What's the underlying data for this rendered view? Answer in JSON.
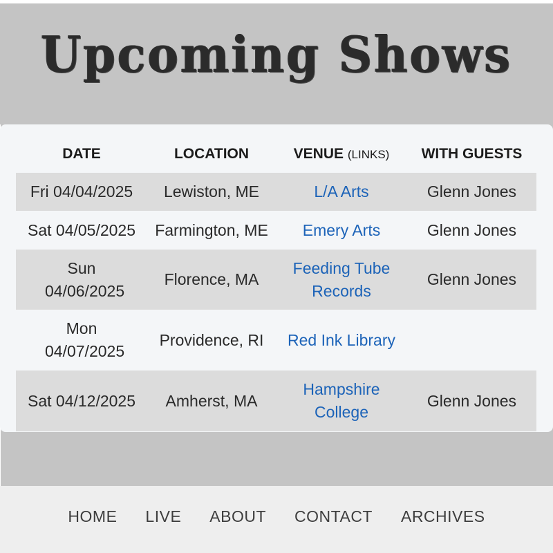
{
  "header": {
    "title": "Upcoming Shows"
  },
  "table": {
    "columns": {
      "date": "DATE",
      "location": "LOCATION",
      "venue": "VENUE",
      "venue_note": "(LINKS)",
      "guests": "WITH GUESTS"
    },
    "rows": [
      {
        "date": "Fri 04/04/2025",
        "location": "Lewiston, ME",
        "venue": "L/A Arts",
        "guests": "Glenn Jones"
      },
      {
        "date": "Sat 04/05/2025",
        "location": "Farmington, ME",
        "venue": "Emery Arts",
        "guests": "Glenn Jones"
      },
      {
        "date": "Sun 04/06/2025",
        "location": "Florence, MA",
        "venue": "Feeding Tube Records",
        "guests": "Glenn Jones"
      },
      {
        "date": "Mon 04/07/2025",
        "location": "Providence, RI",
        "venue": "Red Ink Library",
        "guests": ""
      },
      {
        "date": "Sat 04/12/2025",
        "location": "Amherst, MA",
        "venue": "Hampshire College",
        "guests": "Glenn Jones"
      }
    ]
  },
  "nav": {
    "items": [
      "HOME",
      "LIVE",
      "ABOUT",
      "CONTACT",
      "ARCHIVES"
    ]
  },
  "colors": {
    "link": "#1c63b8",
    "row_shade": "#dcdcdc",
    "background": "#c4c4c4"
  }
}
